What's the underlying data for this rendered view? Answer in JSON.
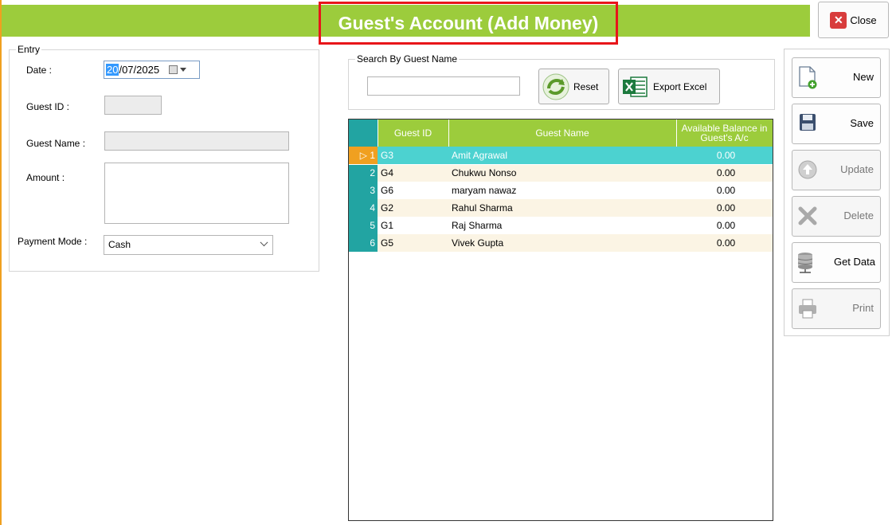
{
  "header": {
    "title": "Guest's Account (Add Money)",
    "close_label": "Close"
  },
  "entry": {
    "legend": "Entry",
    "date_label": "Date :",
    "date_day": "20",
    "date_rest": "/07/2025",
    "guest_id_label": "Guest ID :",
    "guest_id_value": "",
    "guest_name_label": "Guest Name :",
    "guest_name_value": "",
    "amount_label": "Amount :",
    "amount_value": "",
    "payment_mode_label": "Payment Mode :",
    "payment_mode_value": "Cash"
  },
  "search": {
    "legend": "Search By Guest Name",
    "value": "",
    "reset_label": "Reset",
    "export_label": "Export Excel"
  },
  "grid": {
    "columns": [
      "Guest ID",
      "Guest Name",
      "Available Balance in Guest's A/c"
    ],
    "rows": [
      {
        "num": "1",
        "id": "G3",
        "name": "Amit Agrawal",
        "balance": "0.00"
      },
      {
        "num": "2",
        "id": "G4",
        "name": "Chukwu Nonso",
        "balance": "0.00"
      },
      {
        "num": "3",
        "id": "G6",
        "name": "maryam nawaz",
        "balance": "0.00"
      },
      {
        "num": "4",
        "id": "G2",
        "name": "Rahul Sharma",
        "balance": "0.00"
      },
      {
        "num": "5",
        "id": "G1",
        "name": "Raj Sharma",
        "balance": "0.00"
      },
      {
        "num": "6",
        "id": "G5",
        "name": "Vivek Gupta",
        "balance": "0.00"
      }
    ]
  },
  "actions": {
    "new": "New",
    "save": "Save",
    "update": "Update",
    "delete": "Delete",
    "get_data": "Get Data",
    "print": "Print"
  },
  "colors": {
    "header": "#9ccc3c",
    "row_number": "#22a4a2",
    "selected_row": "#4cd2d0",
    "current_row_marker": "#f0a020",
    "title_outline": "#e8151a"
  }
}
